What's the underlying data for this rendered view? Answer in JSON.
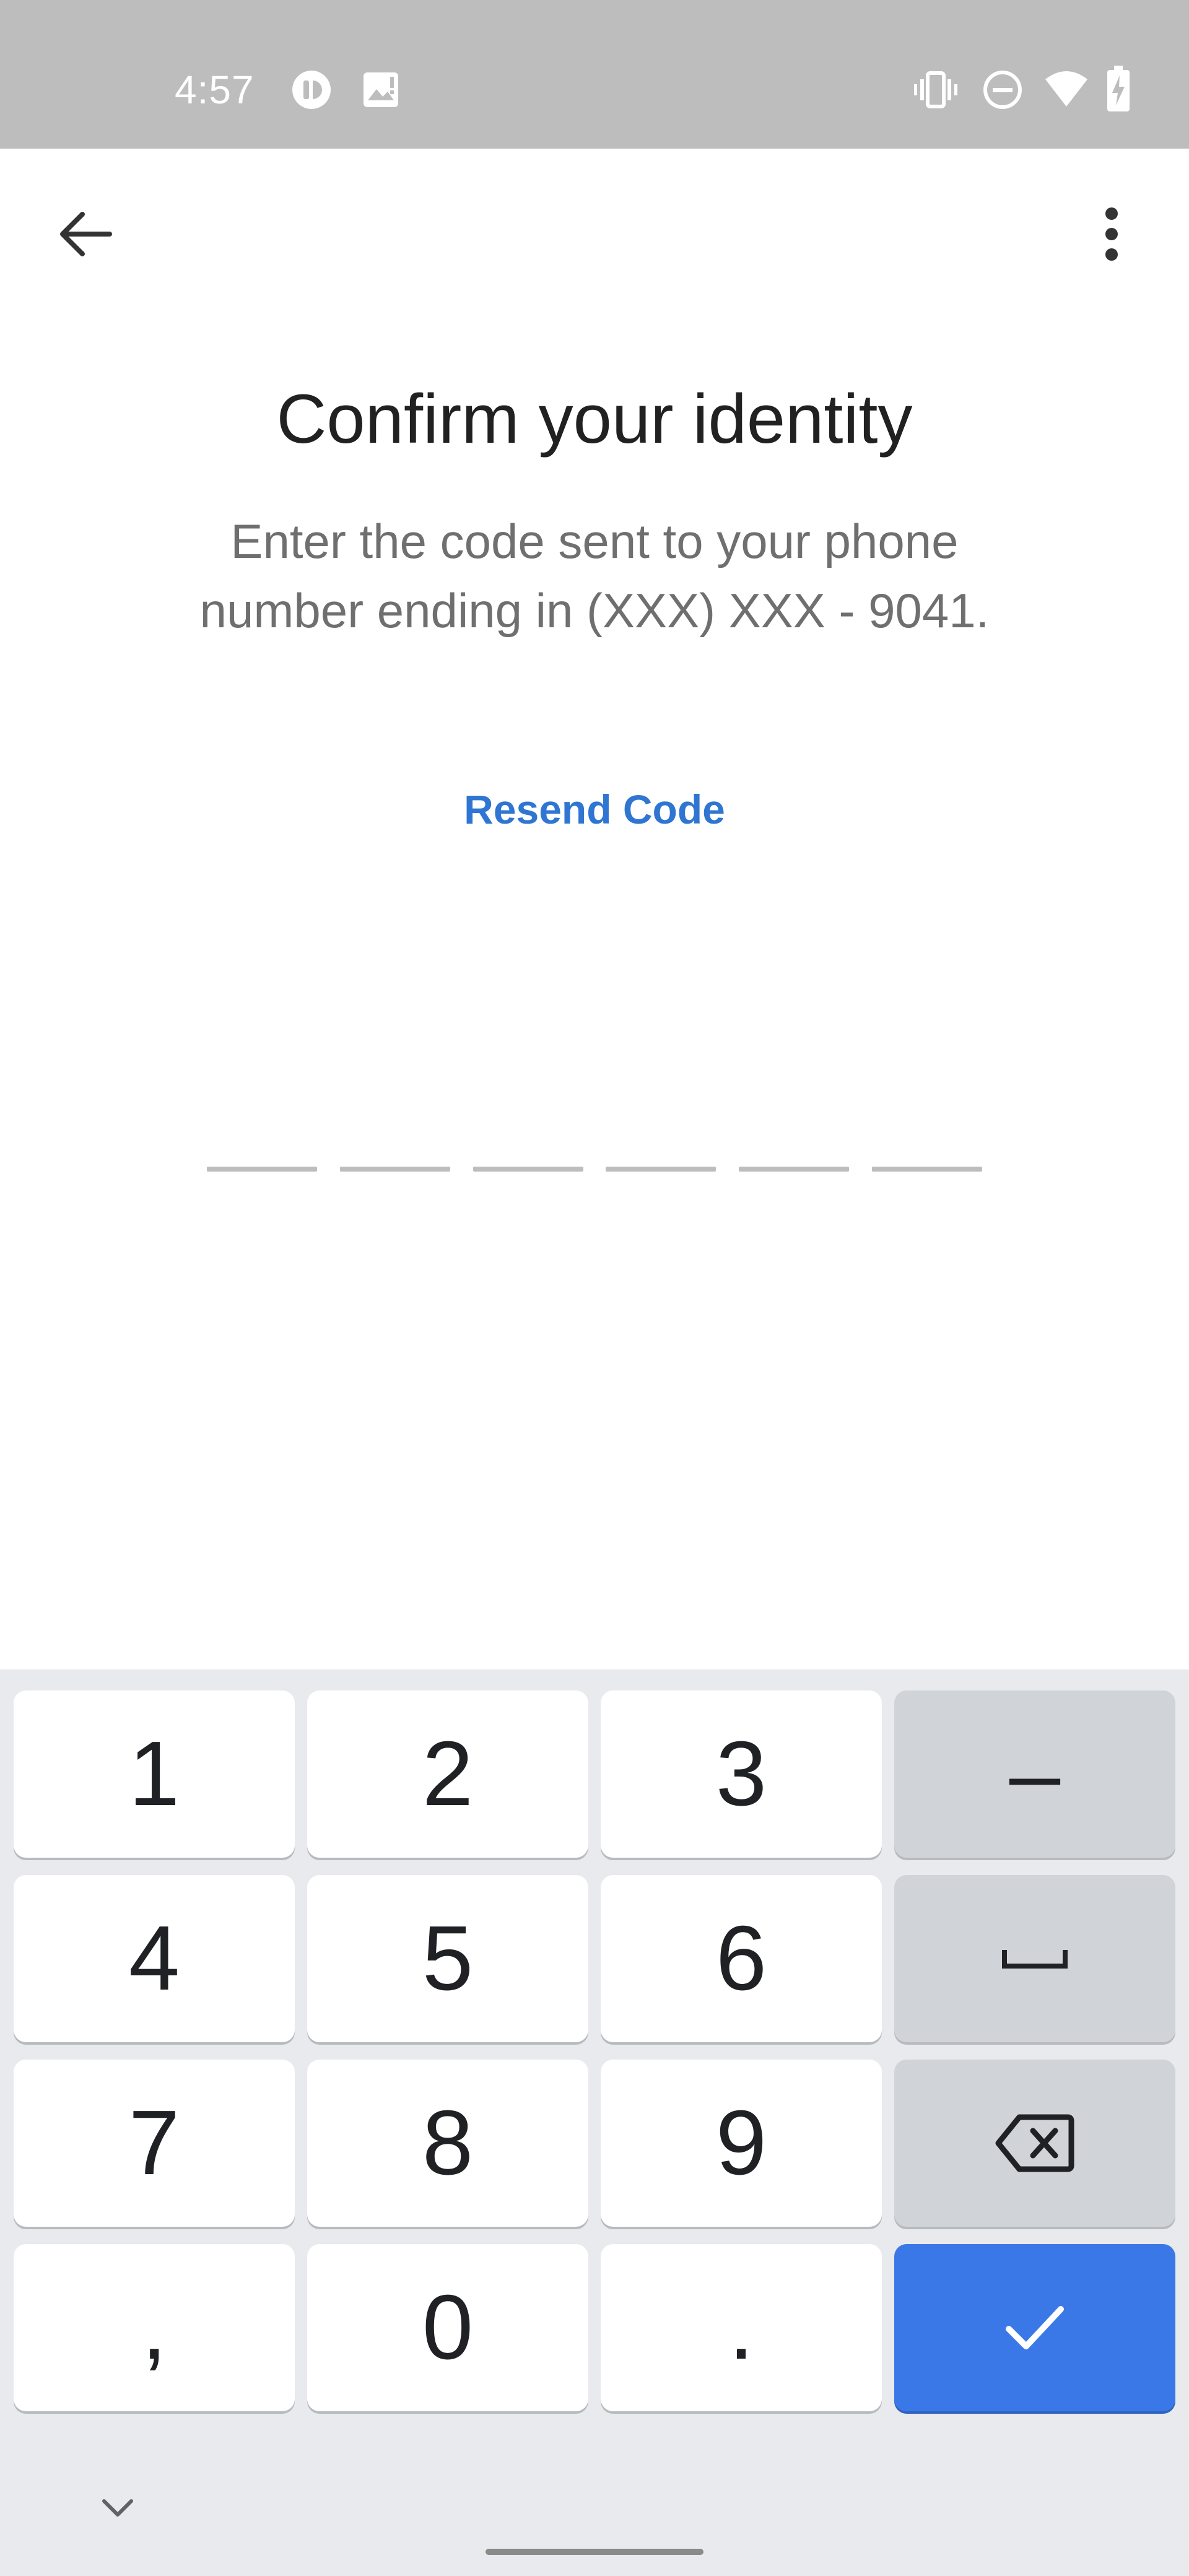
{
  "status_bar": {
    "time": "4:57",
    "left_icons": [
      "app-notification-icon",
      "image-icon"
    ],
    "right_icons": [
      "vibrate-icon",
      "do-not-disturb-icon",
      "wifi-icon",
      "battery-charging-icon"
    ]
  },
  "app_bar": {
    "back_icon": "arrow-back-icon",
    "menu_icon": "more-vert-icon"
  },
  "main": {
    "title": "Confirm your identity",
    "subtitle_line1": "Enter the code sent to your phone",
    "subtitle_line2": "number ending in (XXX) XXX - 9041.",
    "resend_label": "Resend Code",
    "code_length": 6
  },
  "keyboard": {
    "keys": {
      "k1": "1",
      "k2": "2",
      "k3": "3",
      "dash": "–",
      "k4": "4",
      "k5": "5",
      "k6": "6",
      "k7": "7",
      "k8": "8",
      "k9": "9",
      "comma": ",",
      "k0": "0",
      "period": "."
    },
    "special_icons": [
      "space-icon",
      "backspace-icon",
      "checkmark-icon",
      "chevron-down-icon"
    ]
  },
  "colors": {
    "accent": "#2f76d2",
    "done_key": "#3b78e7",
    "status_bar": "#bdbdbd",
    "keyboard_bg": "#e8eaed"
  }
}
